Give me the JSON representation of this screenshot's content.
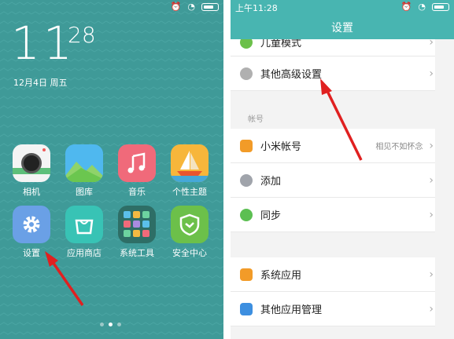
{
  "home": {
    "clock_hours": "11",
    "clock_minutes": "28",
    "date": "12月4日 周五",
    "apps": [
      {
        "label": "相机",
        "icon": "camera-icon"
      },
      {
        "label": "图库",
        "icon": "gallery-icon"
      },
      {
        "label": "音乐",
        "icon": "music-icon"
      },
      {
        "label": "个性主题",
        "icon": "theme-icon"
      },
      {
        "label": "设置",
        "icon": "settings-gear-icon"
      },
      {
        "label": "应用商店",
        "icon": "app-store-icon"
      },
      {
        "label": "系统工具",
        "icon": "system-tools-icon"
      },
      {
        "label": "安全中心",
        "icon": "security-shield-icon"
      }
    ]
  },
  "settings": {
    "status_time": "上午11:28",
    "title": "设置",
    "partial_row": "儿童模式",
    "rows": [
      {
        "label": "其他高级设置",
        "icon": "more-icon",
        "color": "#b0b0b0"
      },
      {
        "label": "小米帐号",
        "value": "相见不如怀念",
        "icon": "mi-account-icon",
        "color": "#f29b28"
      },
      {
        "label": "添加",
        "icon": "add-icon",
        "color": "#a0a4ab"
      },
      {
        "label": "同步",
        "icon": "sync-icon",
        "color": "#5cbf52"
      },
      {
        "label": "系统应用",
        "icon": "system-apps-icon",
        "color": "#f29b28"
      },
      {
        "label": "其他应用管理",
        "icon": "other-apps-icon",
        "color": "#3d8fe0"
      }
    ],
    "section_account": "帐号"
  },
  "colors": {
    "home_bg": "#3f9a98",
    "accent": "#48b5b1",
    "arrow": "#e02020"
  }
}
